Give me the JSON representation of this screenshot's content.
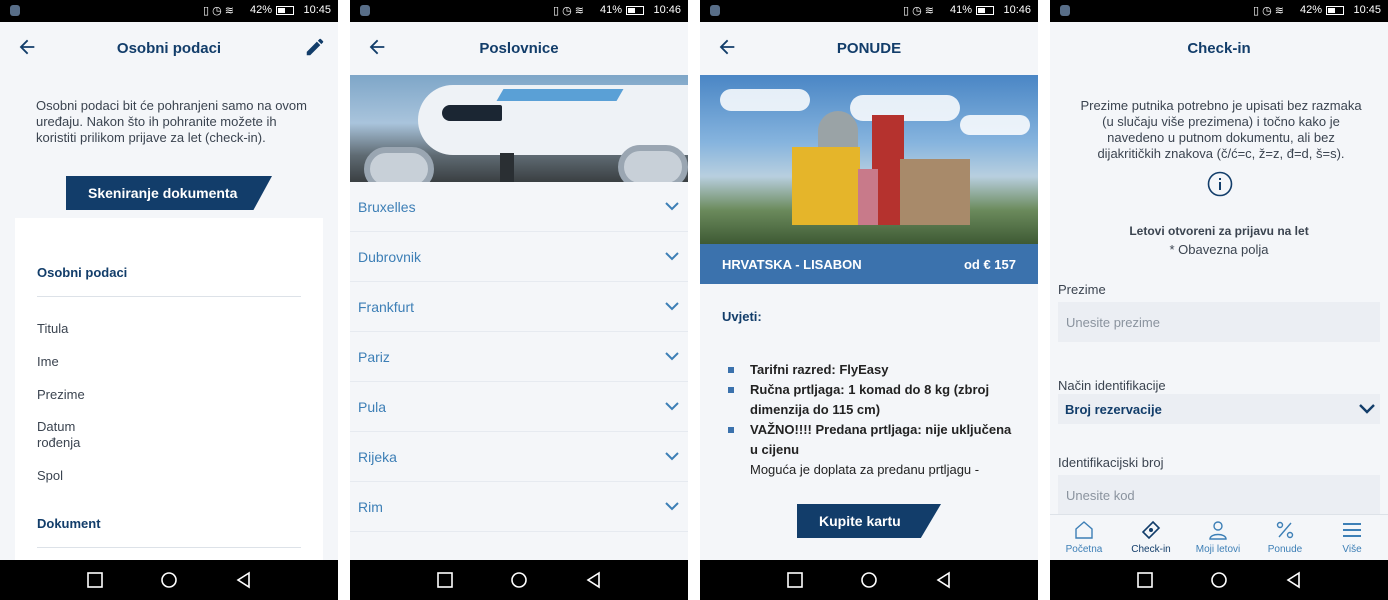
{
  "status_bars": [
    {
      "battery": "42%",
      "time": "10:45"
    },
    {
      "battery": "41%",
      "time": "10:46"
    },
    {
      "battery": "41%",
      "time": "10:46"
    },
    {
      "battery": "42%",
      "time": "10:45"
    }
  ],
  "colors": {
    "primary": "#123d6a",
    "accent": "#3b72ad",
    "link": "#3d7fb6",
    "background": "#f4f6f9"
  },
  "screen1": {
    "title": "Osobni podaci",
    "intro": "Osobni podaci bit će pohranjeni samo na ovom uređaju. Nakon što ih pohranite možete ih koristiti prilikom prijave za let (check-in).",
    "scan_button": "Skeniranje dokumenta",
    "section_personal": "Osobni podaci",
    "fields": [
      "Titula",
      "Ime",
      "Prezime",
      "Datum rođenja",
      "Spol"
    ],
    "section_document": "Dokument"
  },
  "screen2": {
    "title": "Poslovnice",
    "cities": [
      "Bruxelles",
      "Dubrovnik",
      "Frankfurt",
      "Pariz",
      "Pula",
      "Rijeka",
      "Rim"
    ]
  },
  "screen3": {
    "title": "PONUDE",
    "destination": "HRVATSKA - LISABON",
    "price": "od € 157",
    "conditions_title": "Uvjeti:",
    "conditions": [
      "Tarifni razred: FlyEasy",
      "Ručna prtljaga: 1 komad do 8 kg (zbroj dimenzija do 115 cm)",
      " VAŽNO!!!! Predana prtljaga: nije uključena u cijenu"
    ],
    "note": "Moguća je doplata za predanu prtljagu -",
    "buy_button": "Kupite kartu"
  },
  "screen4": {
    "title": "Check-in",
    "intro": "Prezime putnika potrebno je upisati bez razmaka (u slučaju više prezimena) i točno kako je navedeno u putnom dokumentu, ali bez dijakritičkih znakova (č/ć=c, ž=z, đ=d, š=s).",
    "open_title": "Letovi otvoreni za prijavu na let",
    "required": "* Obavezna polja",
    "surname_label": "Prezime",
    "surname_placeholder": "Unesite prezime",
    "id_method_label": "Način identifikacije",
    "id_method_value": "Broj rezervacije",
    "id_number_label": "Identifikacijski broj",
    "id_number_placeholder": "Unesite kod",
    "tabs": [
      {
        "label": "Početna",
        "icon": "home-icon"
      },
      {
        "label": "Check-in",
        "icon": "ticket-icon"
      },
      {
        "label": "Moji letovi",
        "icon": "user-icon"
      },
      {
        "label": "Ponude",
        "icon": "percent-icon"
      },
      {
        "label": "Više",
        "icon": "menu-icon"
      }
    ]
  }
}
